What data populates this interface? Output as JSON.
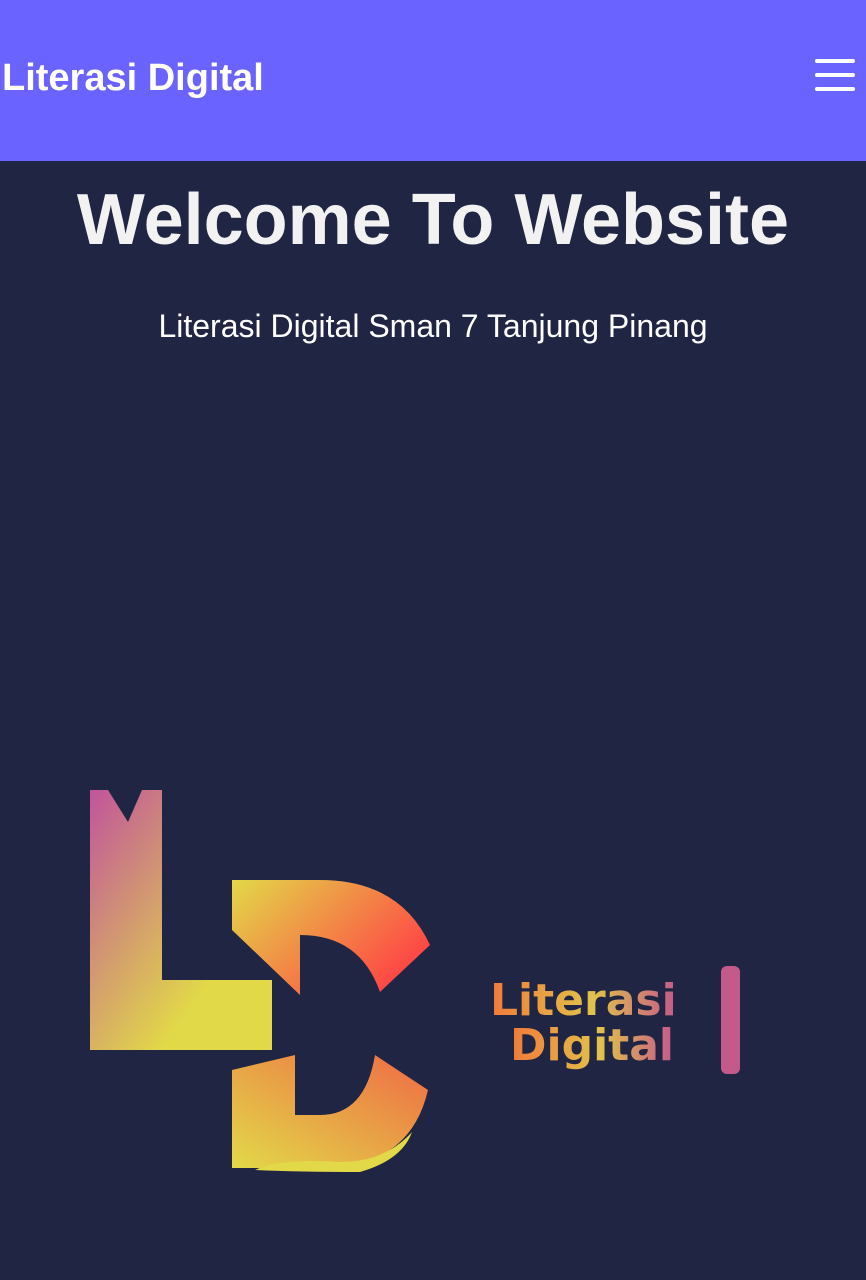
{
  "navbar": {
    "brand": "Literasi Digital",
    "menu_icon": "hamburger-menu-icon",
    "background": "#6b63ff"
  },
  "hero": {
    "title": "Welcome To Website",
    "subtitle": "Literasi Digital Sman 7 Tanjung Pinang"
  },
  "logo": {
    "monogram": "LD",
    "wordmark_line1": "Literasi",
    "wordmark_line2": "Digital"
  },
  "colors": {
    "page_background": "#1f2542",
    "accent": "#6b63ff",
    "logo_gradient": [
      "#c1549c",
      "#e2d948",
      "#ff4545"
    ]
  }
}
